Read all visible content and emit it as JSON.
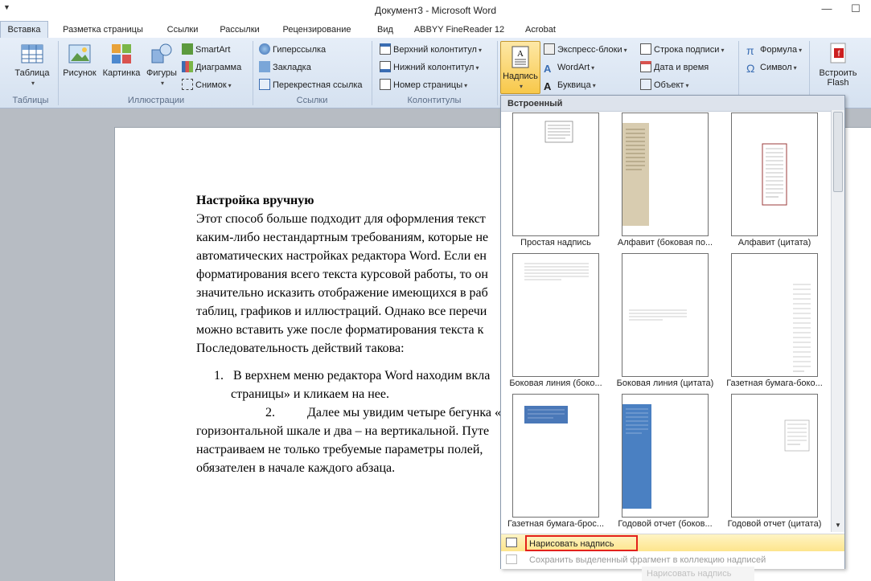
{
  "window": {
    "title": "Документ3  -  Microsoft Word"
  },
  "tabs": [
    {
      "label": "Вставка",
      "active": true
    },
    {
      "label": "Разметка страницы"
    },
    {
      "label": "Ссылки"
    },
    {
      "label": "Рассылки"
    },
    {
      "label": "Рецензирование"
    },
    {
      "label": "Вид"
    },
    {
      "label": "ABBYY FineReader 12"
    },
    {
      "label": "Acrobat"
    }
  ],
  "ribbon": {
    "tables": {
      "button": "Таблица",
      "group": "Таблицы"
    },
    "illustrations": {
      "picture": "Рисунок",
      "clipart": "Картинка",
      "shapes": "Фигуры",
      "smartart": "SmartArt",
      "chart": "Диаграмма",
      "screenshot": "Снимок",
      "group": "Иллюстрации"
    },
    "links": {
      "hyperlink": "Гиперссылка",
      "bookmark": "Закладка",
      "crossref": "Перекрестная ссылка",
      "group": "Ссылки"
    },
    "headerfooter": {
      "header": "Верхний колонтитул",
      "footer": "Нижний колонтитул",
      "pagenum": "Номер страницы",
      "group": "Колонтитулы"
    },
    "text": {
      "textbox": "Надпись",
      "quickparts": "Экспресс-блоки",
      "wordart": "WordArt",
      "dropcap": "Буквица",
      "signature": "Строка подписи",
      "datetime": "Дата и время",
      "object": "Объект"
    },
    "symbols": {
      "equation": "Формула",
      "symbol": "Символ"
    },
    "flash": {
      "line1": "Встроить",
      "line2": "Flash"
    }
  },
  "document": {
    "heading": "Настройка вручную",
    "lines": [
      "Этот способ больше подходит для оформления текст",
      "каким-либо нестандартным требованиям, которые не",
      "автоматических настройках редактора Word. Если ен",
      "форматирования всего текста курсовой работы, то он",
      "значительно исказить отображение имеющихся в раб",
      "таблиц, графиков и иллюстраций. Однако все перечи",
      "можно вставить уже после форматирования текста к",
      "Последовательность действий такова:"
    ],
    "list1_num": "1.",
    "list1_line1": "В верхнем меню редактора Word находим вкла",
    "list1_line2": "страницы» и кликаем на нее.",
    "list2_num": "2.",
    "list2_line1": "Далее мы увидим четыре бегунка «",
    "after_lines": [
      "горизонтальной шкале и два – на вертикальной. Путе",
      "настраиваем не только требуемые параметры полей,",
      "обязателен в начале каждого абзаца."
    ]
  },
  "gallery": {
    "header": "Встроенный",
    "items": [
      "Простая надпись",
      "Алфавит (боковая по...",
      "Алфавит (цитата)",
      "Боковая линия (боко...",
      "Боковая линия (цитата)",
      "Газетная бумага-боко...",
      "Газетная бумага-брос...",
      "Годовой отчет (боков...",
      "Годовой отчет (цитата)"
    ],
    "draw": "Нарисовать надпись",
    "save": "Сохранить выделенный фрагмент в коллекцию надписей",
    "tooltip": "Нарисовать надпись",
    "accent": "#e3211b"
  }
}
